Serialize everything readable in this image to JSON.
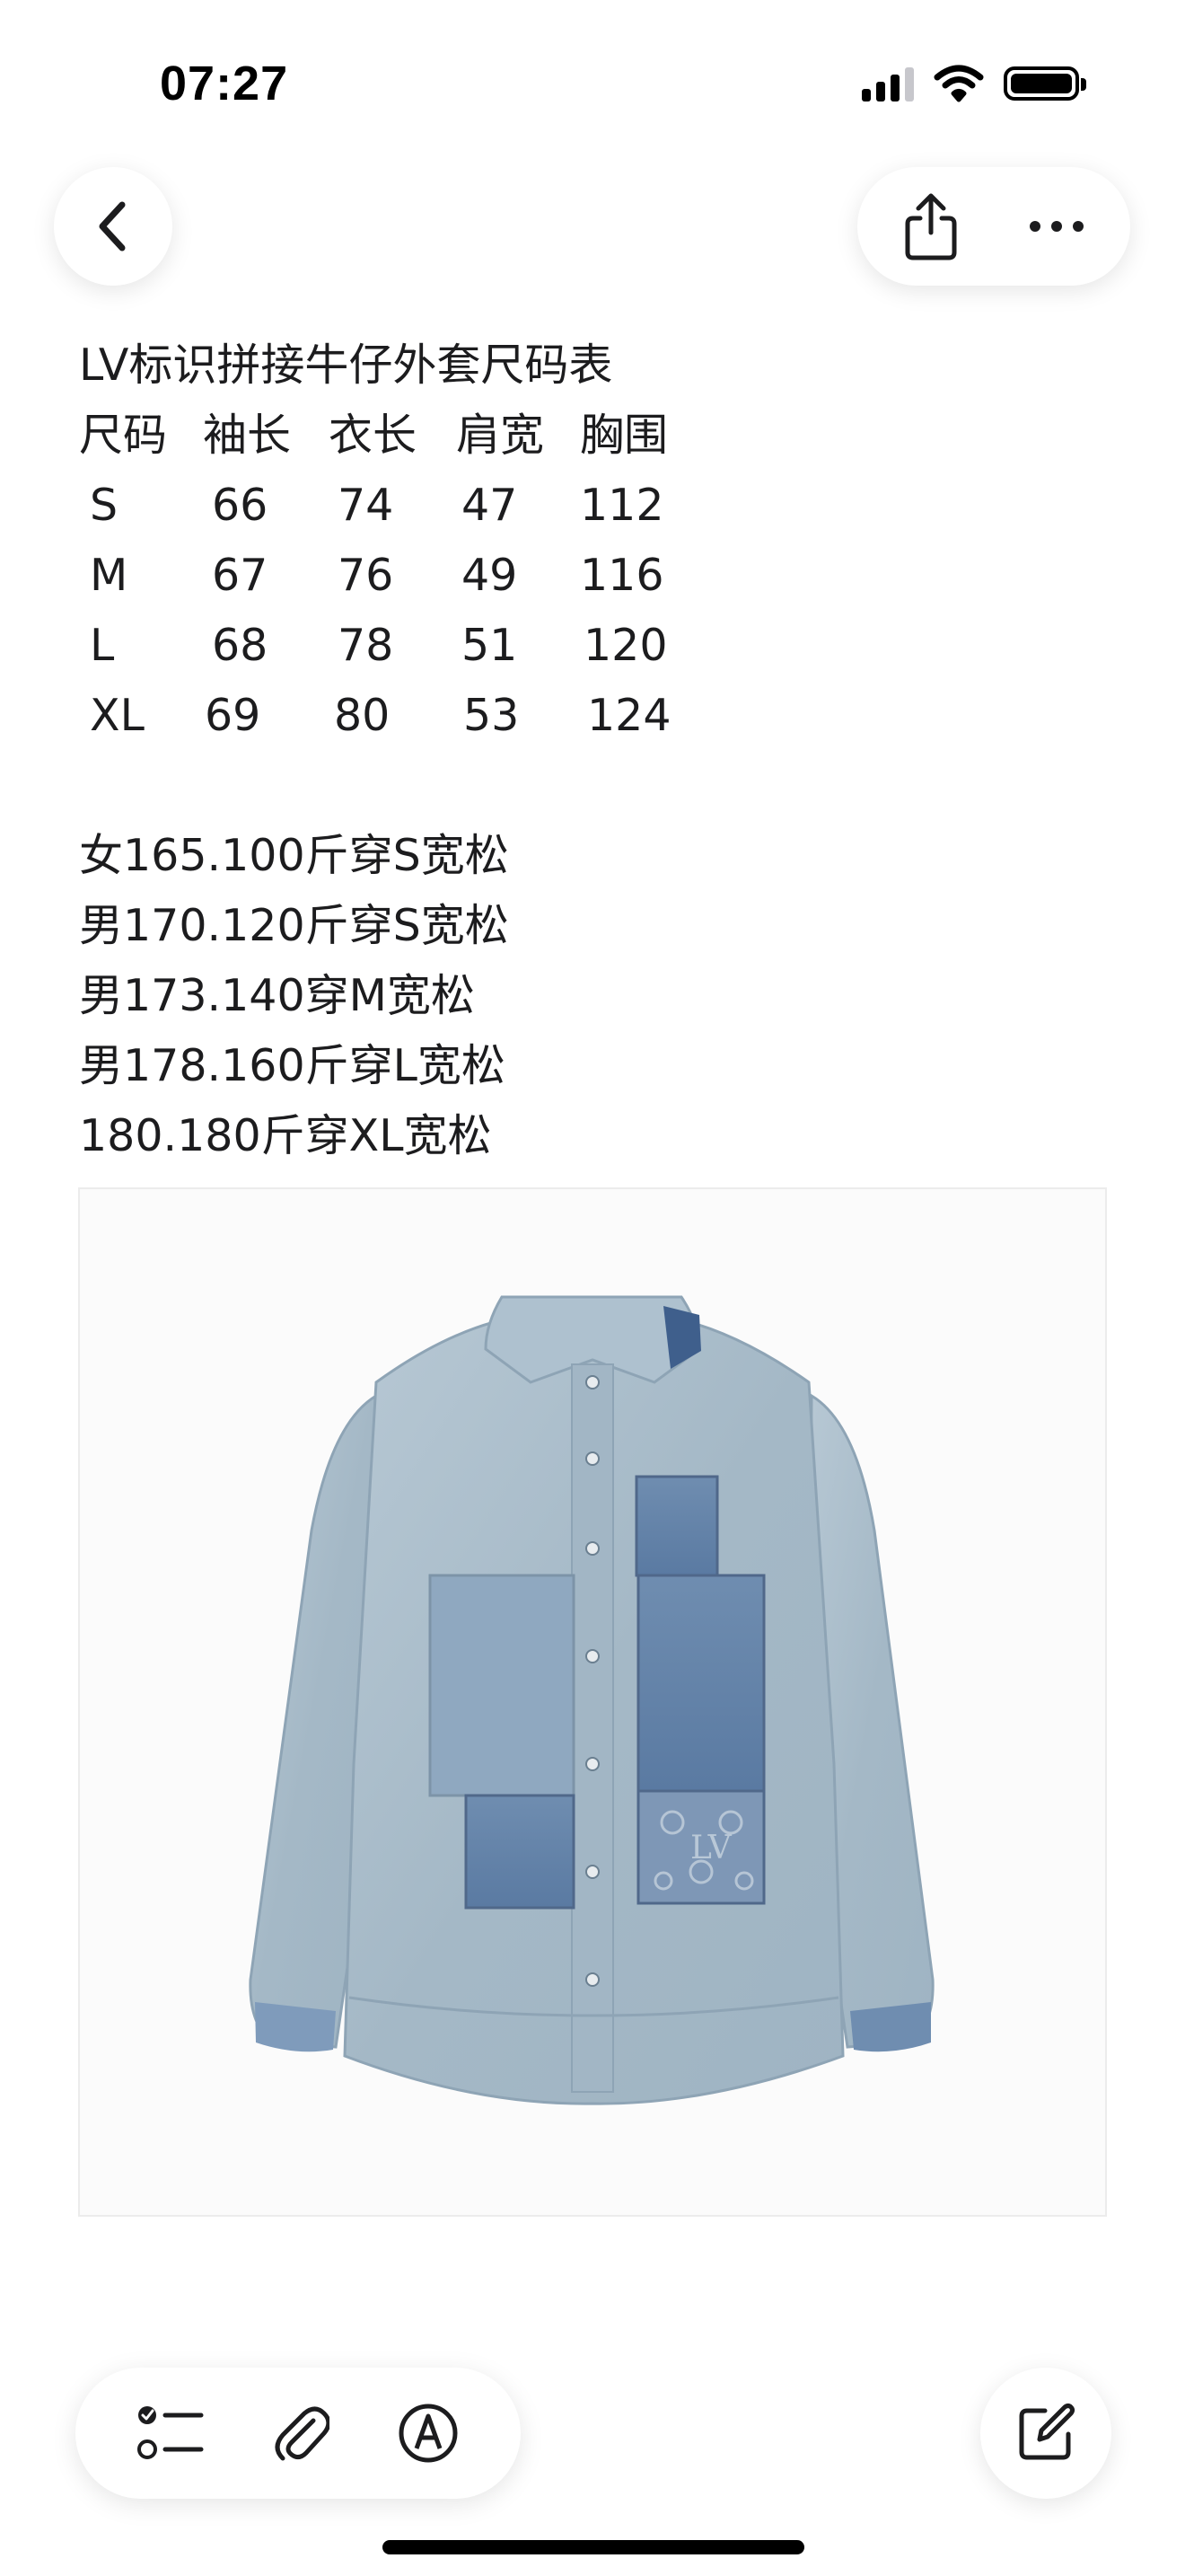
{
  "status_bar": {
    "time": "07:27"
  },
  "note": {
    "title": "LV标识拼接牛仔外套尺码表",
    "size_table": {
      "headers": [
        "尺码",
        "袖长",
        "衣长",
        "肩宽",
        "胸围"
      ],
      "rows": [
        [
          "S",
          "66",
          "74",
          "47",
          "112"
        ],
        [
          "M",
          "67",
          "76",
          "49",
          "116"
        ],
        [
          "L",
          "68",
          "78",
          "51",
          "120"
        ],
        [
          "XL",
          "69",
          "80",
          "53",
          "124"
        ]
      ]
    },
    "fit_notes": [
      "女165.100斤穿S宽松",
      "男170.120斤穿S宽松",
      "男173.140穿M宽松",
      "男178.160斤穿L宽松",
      "180.180斤穿XL宽松"
    ]
  },
  "icons": {
    "back": "chevron-left-icon",
    "share": "share-icon",
    "more": "more-icon",
    "checklist": "checklist-icon",
    "attachment": "paperclip-icon",
    "markup": "markup-pen-icon",
    "compose": "compose-icon"
  },
  "colors": {
    "denim_light": "#a9bccb",
    "denim_dark": "#5f7fa6",
    "background": "#ffffff"
  }
}
